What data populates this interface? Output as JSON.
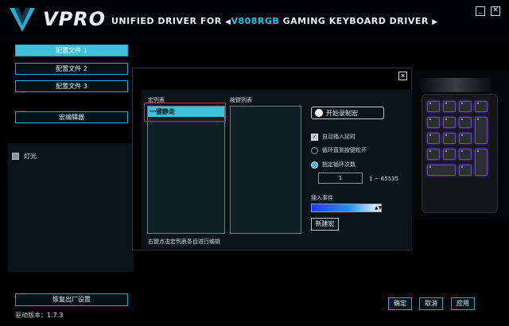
{
  "header": {
    "logo": "VPRO",
    "title_prefix": "UNIFIED DRIVER FOR",
    "title_model": "V808RGB",
    "title_suffix": "GAMING KEYBOARD DRIVER",
    "arrow_left": "◀",
    "arrow_right": "▶",
    "minimize": "_",
    "close": "✕"
  },
  "sidebar": {
    "profiles": [
      "配置文件 1",
      "配置文件 2",
      "配置文件 3"
    ],
    "active_profile": 0,
    "macro_editor": "宏编辑器",
    "light_label": "灯光",
    "reset_label": "恢复出厂设置",
    "version_label": "驱动版本：",
    "version_value": "1.7.3"
  },
  "dialog": {
    "close": "✕",
    "macro_list_label": "宏列表",
    "key_list_label": "按键列表",
    "macro_items": [
      "一键静走"
    ],
    "hint": "右键点击宏列表条目进行编辑",
    "record_button": "开始录制宏",
    "auto_delay": "自动插入延时",
    "loop_until_release": "循环直到按键松开",
    "loop_count_label": "指定循环次数",
    "loop_count_value": "1",
    "range": "1 ~ 65535",
    "insert_event_label": "插入事件",
    "new_macro": "新建宏"
  },
  "footer": {
    "ok": "确定",
    "cancel": "取消",
    "apply": "应用"
  },
  "colors": {
    "accent": "#3fc0dc",
    "border": "#27a9c9",
    "highlight_outline": "#d03030"
  }
}
